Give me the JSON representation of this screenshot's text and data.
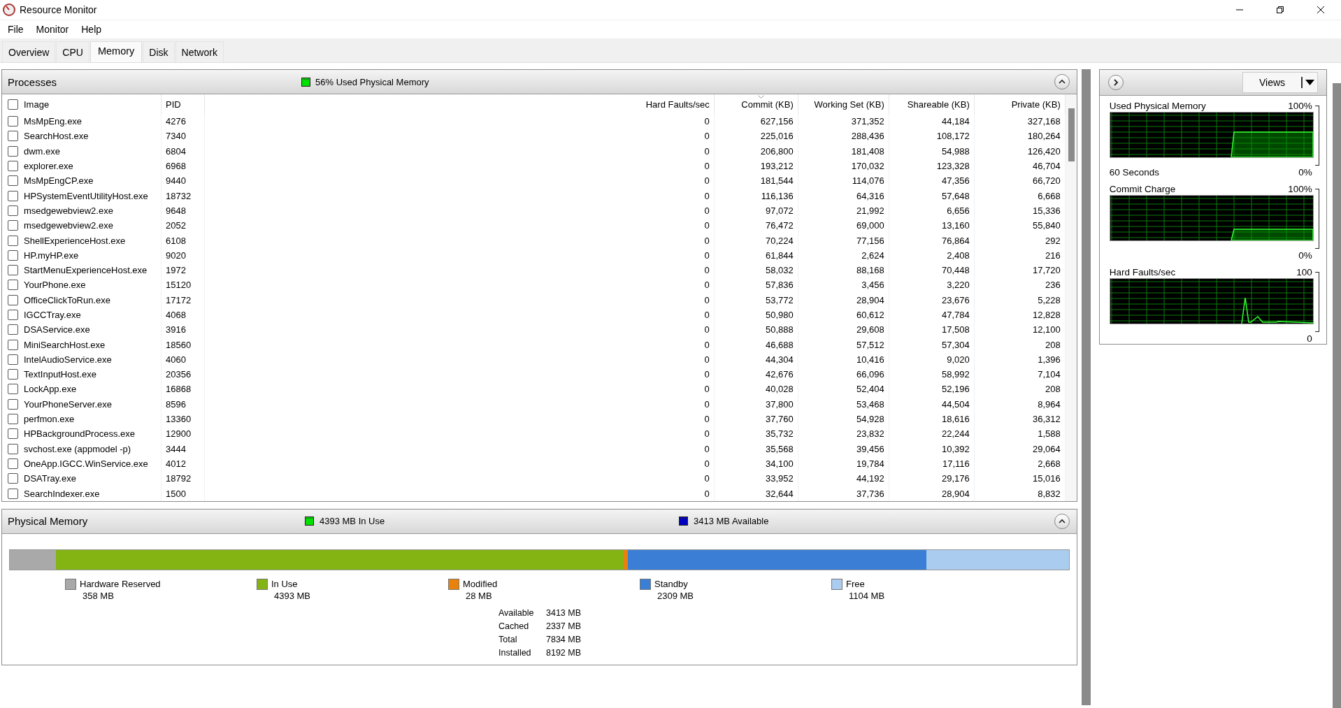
{
  "window": {
    "title": "Resource Monitor"
  },
  "menu": [
    "File",
    "Monitor",
    "Help"
  ],
  "tabs": [
    {
      "label": "Overview",
      "selected": false
    },
    {
      "label": "CPU",
      "selected": false
    },
    {
      "label": "Memory",
      "selected": true
    },
    {
      "label": "Disk",
      "selected": false
    },
    {
      "label": "Network",
      "selected": false
    }
  ],
  "processes": {
    "title": "Processes",
    "summary": "56% Used Physical Memory",
    "expanded": true,
    "columns": [
      {
        "label": "Image",
        "sorted": false
      },
      {
        "label": "PID",
        "sorted": false
      },
      {
        "label": "Hard Faults/sec",
        "sorted": false
      },
      {
        "label": "Commit (KB)",
        "sorted": true
      },
      {
        "label": "Working Set (KB)",
        "sorted": false
      },
      {
        "label": "Shareable (KB)",
        "sorted": false
      },
      {
        "label": "Private (KB)",
        "sorted": false
      }
    ],
    "all_checked": false,
    "rows": [
      {
        "checked": false,
        "cells": [
          "MsMpEng.exe",
          "4276",
          "0",
          "627,156",
          "371,352",
          "44,184",
          "327,168"
        ]
      },
      {
        "checked": false,
        "cells": [
          "SearchHost.exe",
          "7340",
          "0",
          "225,016",
          "288,436",
          "108,172",
          "180,264"
        ]
      },
      {
        "checked": false,
        "cells": [
          "dwm.exe",
          "6804",
          "0",
          "206,800",
          "181,408",
          "54,988",
          "126,420"
        ]
      },
      {
        "checked": false,
        "cells": [
          "explorer.exe",
          "6968",
          "0",
          "193,212",
          "170,032",
          "123,328",
          "46,704"
        ]
      },
      {
        "checked": false,
        "cells": [
          "MsMpEngCP.exe",
          "9440",
          "0",
          "181,544",
          "114,076",
          "47,356",
          "66,720"
        ]
      },
      {
        "checked": false,
        "cells": [
          "HPSystemEventUtilityHost.exe",
          "18732",
          "0",
          "116,136",
          "64,316",
          "57,648",
          "6,668"
        ]
      },
      {
        "checked": false,
        "cells": [
          "msedgewebview2.exe",
          "9648",
          "0",
          "97,072",
          "21,992",
          "6,656",
          "15,336"
        ]
      },
      {
        "checked": false,
        "cells": [
          "msedgewebview2.exe",
          "2052",
          "0",
          "76,472",
          "69,000",
          "13,160",
          "55,840"
        ]
      },
      {
        "checked": false,
        "cells": [
          "ShellExperienceHost.exe",
          "6108",
          "0",
          "70,224",
          "77,156",
          "76,864",
          "292"
        ]
      },
      {
        "checked": false,
        "cells": [
          "HP.myHP.exe",
          "9020",
          "0",
          "61,844",
          "2,624",
          "2,408",
          "216"
        ]
      },
      {
        "checked": false,
        "cells": [
          "StartMenuExperienceHost.exe",
          "1972",
          "0",
          "58,032",
          "88,168",
          "70,448",
          "17,720"
        ]
      },
      {
        "checked": false,
        "cells": [
          "YourPhone.exe",
          "15120",
          "0",
          "57,836",
          "3,456",
          "3,220",
          "236"
        ]
      },
      {
        "checked": false,
        "cells": [
          "OfficeClickToRun.exe",
          "17172",
          "0",
          "53,772",
          "28,904",
          "23,676",
          "5,228"
        ]
      },
      {
        "checked": false,
        "cells": [
          "IGCCTray.exe",
          "4068",
          "0",
          "50,980",
          "60,612",
          "47,784",
          "12,828"
        ]
      },
      {
        "checked": false,
        "cells": [
          "DSAService.exe",
          "3916",
          "0",
          "50,888",
          "29,608",
          "17,508",
          "12,100"
        ]
      },
      {
        "checked": false,
        "cells": [
          "MiniSearchHost.exe",
          "18560",
          "0",
          "46,688",
          "57,512",
          "57,304",
          "208"
        ]
      },
      {
        "checked": false,
        "cells": [
          "IntelAudioService.exe",
          "4060",
          "0",
          "44,304",
          "10,416",
          "9,020",
          "1,396"
        ]
      },
      {
        "checked": false,
        "cells": [
          "TextInputHost.exe",
          "20356",
          "0",
          "42,676",
          "66,096",
          "58,992",
          "7,104"
        ]
      },
      {
        "checked": false,
        "cells": [
          "LockApp.exe",
          "16868",
          "0",
          "40,028",
          "52,404",
          "52,196",
          "208"
        ]
      },
      {
        "checked": false,
        "cells": [
          "YourPhoneServer.exe",
          "8596",
          "0",
          "37,800",
          "53,468",
          "44,504",
          "8,964"
        ]
      },
      {
        "checked": false,
        "cells": [
          "perfmon.exe",
          "13360",
          "0",
          "37,760",
          "54,928",
          "18,616",
          "36,312"
        ]
      },
      {
        "checked": false,
        "cells": [
          "HPBackgroundProcess.exe",
          "12900",
          "0",
          "35,732",
          "23,832",
          "22,244",
          "1,588"
        ]
      },
      {
        "checked": false,
        "cells": [
          "svchost.exe (appmodel -p)",
          "3444",
          "0",
          "35,568",
          "39,456",
          "10,392",
          "29,064"
        ]
      },
      {
        "checked": false,
        "cells": [
          "OneApp.IGCC.WinService.exe",
          "4012",
          "0",
          "34,100",
          "19,784",
          "17,116",
          "2,668"
        ]
      },
      {
        "checked": false,
        "cells": [
          "DSATray.exe",
          "18792",
          "0",
          "33,952",
          "44,192",
          "29,176",
          "15,016"
        ]
      },
      {
        "checked": false,
        "cells": [
          "SearchIndexer.exe",
          "1500",
          "0",
          "32,644",
          "37,736",
          "28,904",
          "8,832"
        ]
      }
    ]
  },
  "physical_memory": {
    "title": "Physical Memory",
    "expanded": true,
    "indicators": [
      {
        "text": "4393 MB In Use",
        "color": "#00e000"
      },
      {
        "text": "3413 MB Available",
        "color": "#0000c0"
      }
    ],
    "segments": [
      {
        "label": "Hardware Reserved",
        "value": "358 MB",
        "color": "#a9a9a9"
      },
      {
        "label": "In Use",
        "value": "4393 MB",
        "color": "#84b413"
      },
      {
        "label": "Modified",
        "value": "28 MB",
        "color": "#e8820c"
      },
      {
        "label": "Standby",
        "value": "2309 MB",
        "color": "#3a7fd5"
      },
      {
        "label": "Free",
        "value": "1104 MB",
        "color": "#a9ccef"
      }
    ],
    "stats": [
      {
        "label": "Available",
        "value": "3413 MB"
      },
      {
        "label": "Cached",
        "value": "2337 MB"
      },
      {
        "label": "Total",
        "value": "7834 MB"
      },
      {
        "label": "Installed",
        "value": "8192 MB"
      }
    ]
  },
  "side_panel": {
    "views_button": "Views",
    "graphs": [
      {
        "kind": "area",
        "title": "Used Physical Memory",
        "max": "100%",
        "min": "0%",
        "time_span": "60 Seconds"
      },
      {
        "kind": "area",
        "title": "Commit Charge",
        "max": "100%",
        "min": "0%"
      },
      {
        "kind": "spike",
        "title": "Hard Faults/sec",
        "max": "100",
        "min": "0"
      }
    ]
  }
}
